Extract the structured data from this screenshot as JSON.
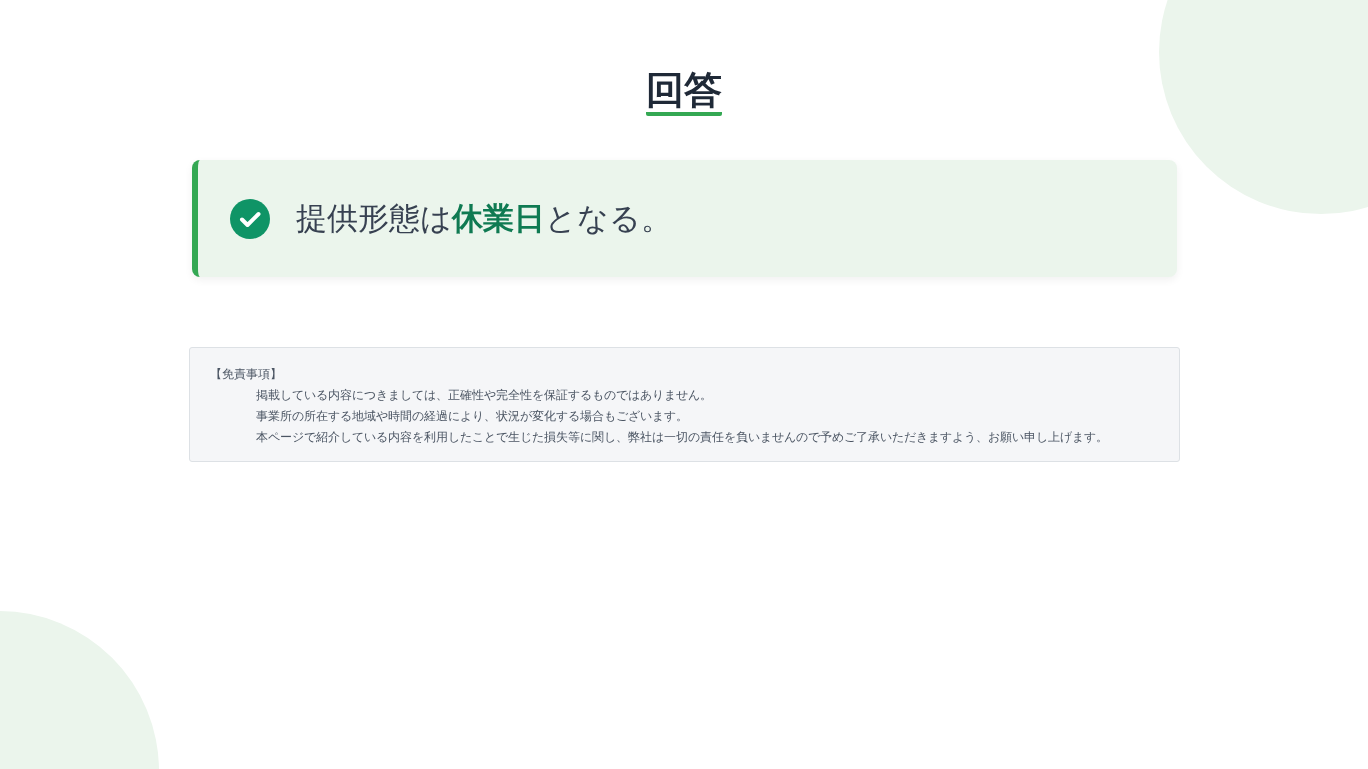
{
  "title": "回答",
  "answer": {
    "text": "提供形態は**休業日**となる。"
  },
  "disclaimer": {
    "heading": "【免責事項】",
    "lines": [
      "掲載している内容につきましては、正確性や完全性を保証するものではありません。",
      "事業所の所在する地域や時間の経過により、状況が変化する場合もございます。",
      "本ページで紹介している内容を利用したことで生じた損失等に関し、弊社は一切の責任を負いませんので予めご了承いただきますよう、お願い申し上げます。"
    ]
  }
}
